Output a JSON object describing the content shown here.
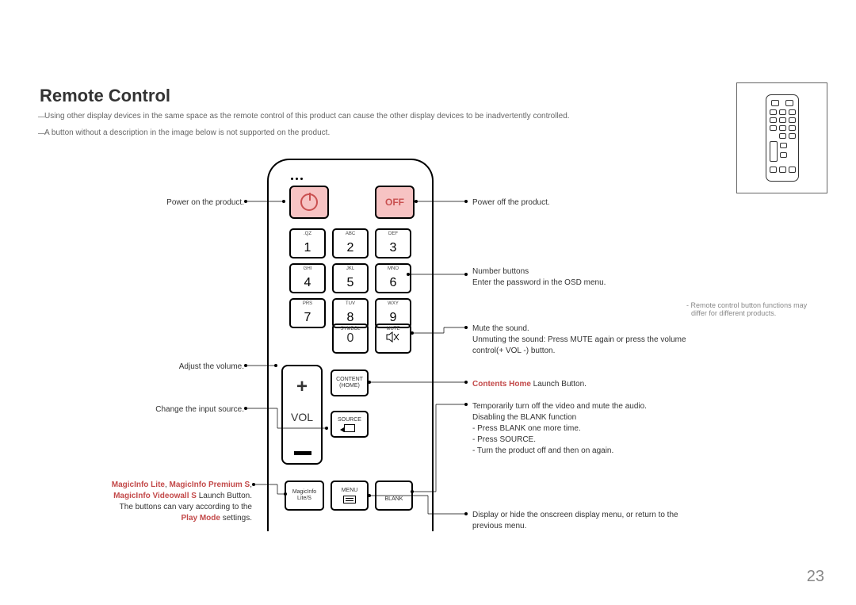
{
  "title": "Remote Control",
  "notes": {
    "n1": "Using other display devices in the same space as the remote control of this product can cause the other display devices to be inadvertently controlled.",
    "n2": "A button without a description in the image below is not supported on the product."
  },
  "remote": {
    "off_label": "OFF",
    "numbers": [
      {
        "sup": ".QZ",
        "digit": "1"
      },
      {
        "sup": "ABC",
        "digit": "2"
      },
      {
        "sup": "DEF",
        "digit": "3"
      },
      {
        "sup": "GHI",
        "digit": "4"
      },
      {
        "sup": "JKL",
        "digit": "5"
      },
      {
        "sup": "MNO",
        "digit": "6"
      },
      {
        "sup": "PRS",
        "digit": "7"
      },
      {
        "sup": "TUV",
        "digit": "8"
      },
      {
        "sup": "WXY",
        "digit": "9"
      }
    ],
    "zero": {
      "sup": "SYMBOL",
      "digit": "0"
    },
    "mute_sup": "MUTE",
    "vol": {
      "plus": "+",
      "label": "VOL"
    },
    "content_l1": "CONTENT",
    "content_l2": "(HOME)",
    "source_label": "SOURCE",
    "magic_l1": "MagicInfo",
    "magic_l2": "Lite/S",
    "menu_label": "MENU",
    "blank_label": "BLANK"
  },
  "left_callouts": {
    "power_on": "Power on the product.",
    "volume": "Adjust the volume.",
    "input_source": "Change the input source.",
    "magic_r1": "MagicInfo Lite",
    "magic_r2": "MagicInfo Premium S",
    "magic_r3": "MagicInfo Videowall S",
    "magic_t1": " Launch Button.",
    "magic_line2": "The buttons can vary according to the ",
    "magic_r4": "Play Mode",
    "magic_t2": " settings."
  },
  "right_callouts": {
    "power_off": "Power off the product.",
    "num_l1": "Number buttons",
    "num_l2": "Enter the password in the OSD menu.",
    "mute_l1": "Mute the sound.",
    "mute_l2": "Unmuting the sound: Press MUTE again or press the volume control(+ VOL -) button.",
    "contents_home_r": "Contents Home",
    "contents_home_t": " Launch Button.",
    "blankfn_l1": "Temporarily turn off the video and mute the audio.",
    "blankfn_l2": "Disabling the BLANK function",
    "blankfn_l3": "- Press BLANK one more time.",
    "blankfn_l4": "- Press SOURCE.",
    "blankfn_l5": "- Turn the product off and then on again.",
    "menu_desc": "Display or hide the onscreen display menu, or return to the previous menu."
  },
  "side_note": "Remote control button functions may differ for different products.",
  "page_number": "23"
}
